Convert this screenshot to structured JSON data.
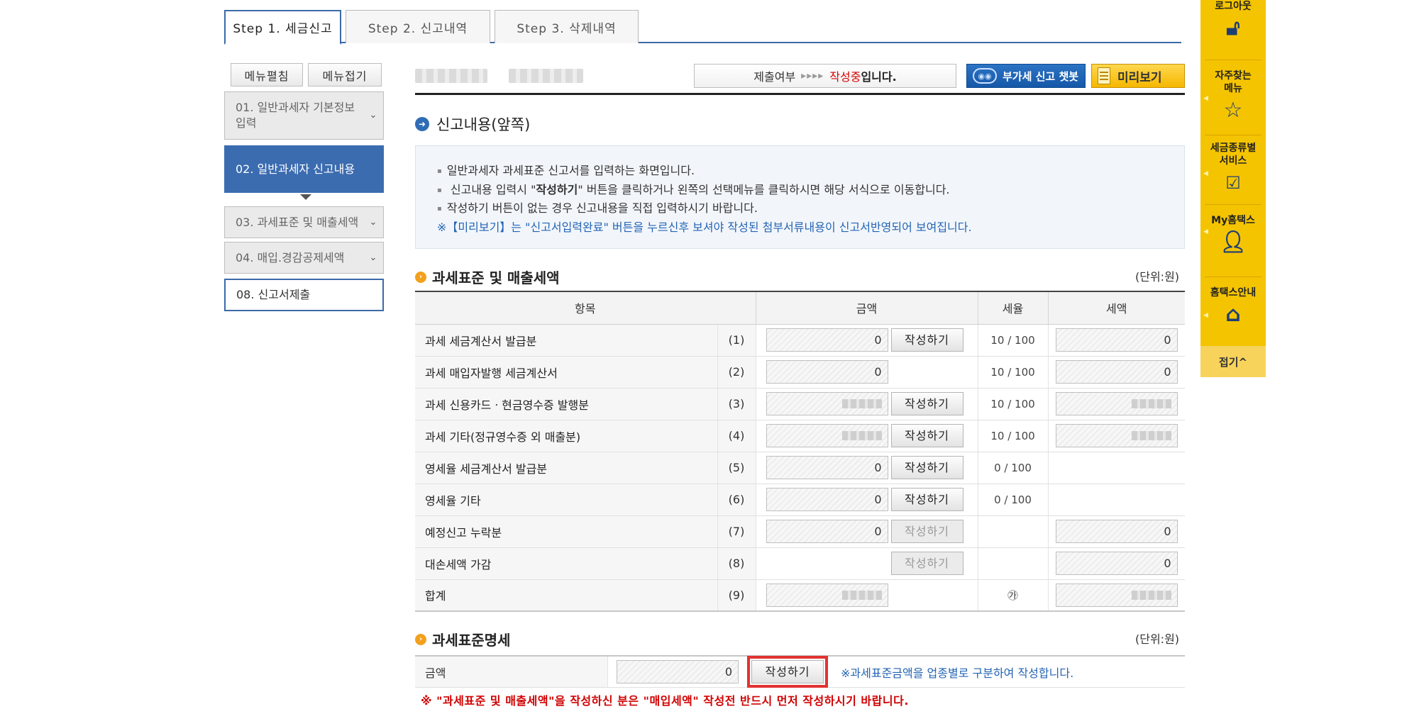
{
  "steps": [
    {
      "label": "Step 1. 세금신고"
    },
    {
      "label": "Step 2. 신고내역"
    },
    {
      "label": "Step 3. 삭제내역"
    }
  ],
  "sidebar": {
    "expand_label": "메뉴펼침",
    "collapse_label": "메뉴접기",
    "items": [
      {
        "label": "01. 일반과세자 기본정보 입력"
      },
      {
        "label": "02. 일반과세자 신고내용"
      },
      {
        "label": "03. 과세표준 및 매출세액"
      },
      {
        "label": "04. 매입.경감공제세액"
      },
      {
        "label": "08. 신고서제출"
      }
    ]
  },
  "status": {
    "prefix": "제출여부",
    "arrows": "▸▸▸▸",
    "state": "작성중",
    "suffix": "입니다."
  },
  "buttons": {
    "chatbot": "부가세 신고 챗봇",
    "preview": "미리보기"
  },
  "section": {
    "title": "신고내용(앞쪽)",
    "notices": [
      "일반과세자 과세표준 신고서를 입력하는 화면입니다.",
      "신고내용 입력시 \"작성하기\" 버튼을 클릭하거나 왼쪽의 선택메뉴를 클릭하시면 해당 서식으로 이동합니다.",
      "작성하기 버튼이 없는 경우 신고내용을 직접 입력하시기 바랍니다."
    ],
    "note": "※【미리보기】는 \"신고서입력완료\" 버튼을 누르신후 보셔야 작성된 첨부서류내용이 신고서반영되어 보여집니다."
  },
  "sales_table": {
    "title": "과세표준 및 매출세액",
    "unit": "(단위:원)",
    "headers": [
      "항목",
      "금액",
      "세율",
      "세액"
    ],
    "write_label": "작성하기",
    "rows": [
      {
        "item": "과세 세금계산서 발급분",
        "no": "(1)",
        "amount": "0",
        "rate": "10 / 100",
        "tax": "0"
      },
      {
        "item": "과세 매입자발행 세금계산서",
        "no": "(2)",
        "amount": "0",
        "rate": "10 / 100",
        "tax": "0"
      },
      {
        "item": "과세 신용카드ㆍ현금영수증 발행분",
        "no": "(3)",
        "amount": "",
        "rate": "10 / 100",
        "tax": ""
      },
      {
        "item": "과세 기타(정규영수증 외 매출분)",
        "no": "(4)",
        "amount": "",
        "rate": "10 / 100",
        "tax": ""
      },
      {
        "item": "영세율 세금계산서 발급분",
        "no": "(5)",
        "amount": "0",
        "rate": "0 / 100",
        "tax": ""
      },
      {
        "item": "영세율 기타",
        "no": "(6)",
        "amount": "0",
        "rate": "0 / 100",
        "tax": ""
      },
      {
        "item": "예정신고 누락분",
        "no": "(7)",
        "amount": "0",
        "rate": "",
        "tax": "0"
      },
      {
        "item": "대손세액 가감",
        "no": "(8)",
        "amount": "",
        "rate": "",
        "tax": "0"
      },
      {
        "item": "합계",
        "no": "(9)",
        "amount": "",
        "rate": "㉮",
        "tax": ""
      }
    ]
  },
  "breakdown": {
    "title": "과세표준명세",
    "unit": "(단위:원)",
    "label": "금액",
    "amount": "0",
    "write_label": "작성하기",
    "hint": "※과세표준금액을 업종별로 구분하여 작성합니다."
  },
  "warning": "※ \"과세표준 및 매출세액\"을 작성하신 분은 \"매입세액\" 작성전 반드시 먼저 작성하시기 바랍니다.",
  "quick_menu": {
    "logout": "로그아웃",
    "faq_line1": "자주찾는",
    "faq_line2": "메뉴",
    "tax_line1": "세금종류별",
    "tax_line2": "서비스",
    "my": "My홈택스",
    "guide": "홈택스안내",
    "fold": "접기^"
  },
  "colors": {
    "accent_blue": "#3c6cb0",
    "quick_menu_yellow": "#f5c400",
    "warning_red": "#d00000",
    "highlight_red": "#e23232"
  }
}
